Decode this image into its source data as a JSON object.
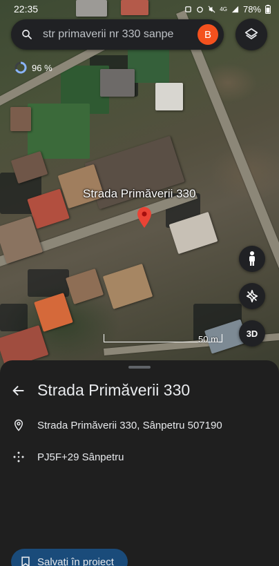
{
  "status_bar": {
    "time": "22:35",
    "battery": "78%",
    "network": "4G"
  },
  "search": {
    "query": "str primaverii nr 330 sanpe",
    "avatar_letter": "B"
  },
  "map": {
    "accuracy": "96 %",
    "place_label": "Strada Primăverii 330",
    "scale_label": "50 m",
    "mode_3d_label": "3D"
  },
  "sheet": {
    "title": "Strada Primăverii 330",
    "address": "Strada Primăverii 330, Sânpetru 507190",
    "plus_code": "PJ5F+29 Sânpetru",
    "save_label": "Salvați în proiect"
  },
  "colors": {
    "pin": "#ea4335",
    "avatar": "#f4511e",
    "save_button": "#1a4b7a"
  },
  "icons": {
    "search": "search-icon",
    "layers": "layers-icon",
    "street_view": "pegman-icon",
    "north": "compass-icon",
    "back": "arrow-left-icon",
    "location": "location-pin-icon",
    "plus_code": "plus-code-icon",
    "bookmark": "bookmark-icon"
  }
}
